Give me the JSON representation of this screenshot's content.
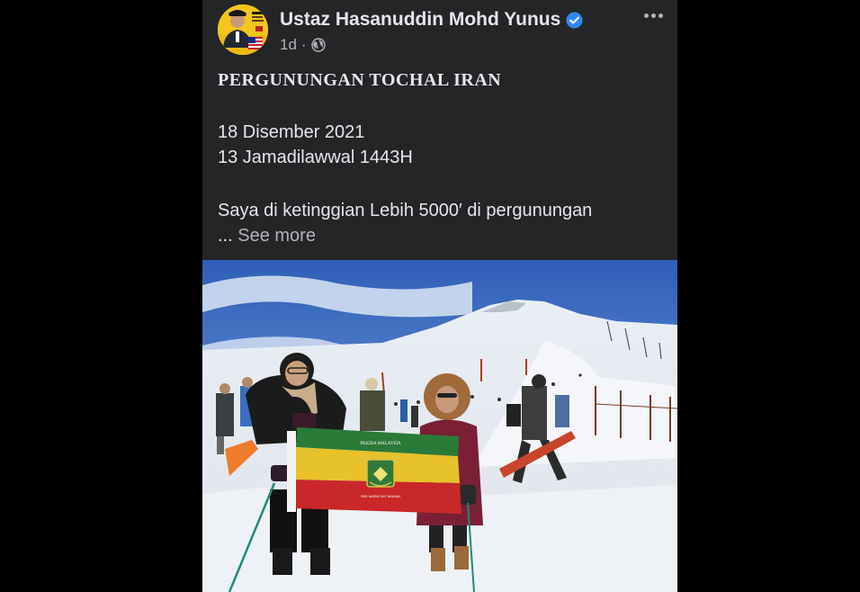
{
  "post": {
    "author": "Ustaz Hasanuddin Mohd Yunus",
    "time": "1d",
    "separator": "·",
    "headline": "PERGUNUNGAN TOCHAL IRAN",
    "date_line": "18 Disember 2021",
    "hijri_line": "13 Jamadilawwal 1443H",
    "body_line": "Saya di ketinggian Lebih 5000′ di pergunungan",
    "ellipsis": "...",
    "see_more": "See more",
    "flag_text_top": "PEKIDA MALAYSIA",
    "flag_text_bottom": "SIRI MARA SAY MAKAN"
  },
  "icons": {
    "verified": "verified-badge-icon",
    "audience": "globe-icon",
    "more": "more-options-icon"
  },
  "colors": {
    "card_bg": "#242526",
    "text_primary": "#e4e6eb",
    "text_secondary": "#b0b3b8",
    "verified_blue": "#2d88ff"
  }
}
